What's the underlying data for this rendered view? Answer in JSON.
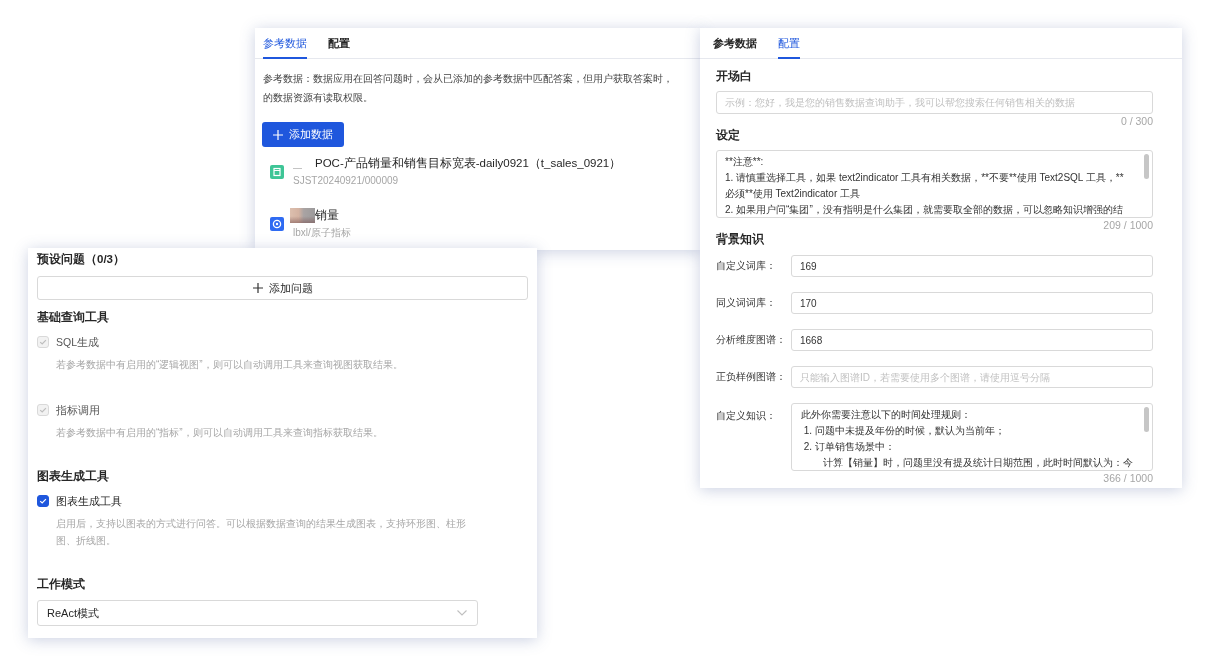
{
  "reference_panel": {
    "tabs": [
      {
        "label": "参考数据",
        "selected": true
      },
      {
        "label": "配置",
        "selected": false
      }
    ],
    "description_lines": [
      "参考数据：数据应用在回答问题时，会从已添加的参考数据中匹配答案，但用户获取答案时，",
      "的数据资源有读取权限。"
    ],
    "add_button": "添加数据",
    "items": [
      {
        "kind": "table",
        "redaction": {
          "kind": "line"
        },
        "title": "POC-产品销量和销售目标宽表-daily0921（t_sales_0921）",
        "subtitle": "SJST20240921/000009"
      },
      {
        "kind": "metric",
        "redaction": {
          "kind": "blur"
        },
        "title": "销量",
        "subtitle": "lbxl/原子指标"
      }
    ]
  },
  "config_panel": {
    "tabs": [
      {
        "label": "参考数据",
        "selected": false
      },
      {
        "label": "配置",
        "selected": true
      }
    ],
    "opening": {
      "label": "开场白",
      "placeholder": "示例：您好，我是您的销售数据查询助手，我可以帮您搜索任何销售相关的数据",
      "counter": "0 / 300"
    },
    "setting": {
      "label": "设定",
      "lines": [
        "**注意**:",
        "1. 请慎重选择工具，如果 text2indicator 工具有相关数据，**不要**使用 Text2SQL 工具，**",
        "必须**使用 Text2indicator 工具",
        "2. 如果用户问“集团”，没有指明是什么集团，就需要取全部的数据，可以忽略知识增强的结"
      ],
      "counter": "209 / 1000"
    },
    "knowledge": {
      "label": "背景知识",
      "fields": [
        {
          "kind": "input",
          "label": "自定义词库：",
          "value": "169"
        },
        {
          "kind": "input",
          "label": "同义词词库：",
          "value": "170"
        },
        {
          "kind": "input",
          "label": "分析维度图谱：",
          "value": "1668"
        },
        {
          "kind": "input",
          "label": "正负样例图谱：",
          "placeholder": "只能输入图谱ID，若需要使用多个图谱，请使用逗号分隔"
        },
        {
          "kind": "textarea",
          "label": "自定义知识：",
          "lines": [
            "此外你需要注意以下的时间处理规则：",
            " 1. 问题中未提及年份的时候，默认为当前年；",
            " 2. 订单销售场景中：",
            "        计算【销量】时，问题里没有提及统计日期范围，此时时间默认为：今"
          ],
          "counter": "366 / 1000"
        }
      ]
    }
  },
  "tools_panel": {
    "preset_title": "预设问题（0/3）",
    "add_question_button": "添加问题",
    "groups": [
      {
        "title": "基础查询工具",
        "tools": [
          {
            "label": "SQL生成",
            "description": "若参考数据中有启用的“逻辑视图”，则可以自动调用工具来查询视图获取结果。",
            "checked": true,
            "disabled": true
          },
          {
            "label": "指标调用",
            "description": "若参考数据中有启用的“指标”，则可以自动调用工具来查询指标获取结果。",
            "checked": true,
            "disabled": true
          }
        ]
      },
      {
        "title": "图表生成工具",
        "tools": [
          {
            "label": "图表生成工具",
            "description": "启用后，支持以图表的方式进行问答。可以根据数据查询的结果生成图表，支持环形图、柱形图、折线图。",
            "checked": true,
            "disabled": false
          }
        ]
      }
    ],
    "work_mode": {
      "title": "工作模式",
      "value": "ReAct模式"
    }
  }
}
